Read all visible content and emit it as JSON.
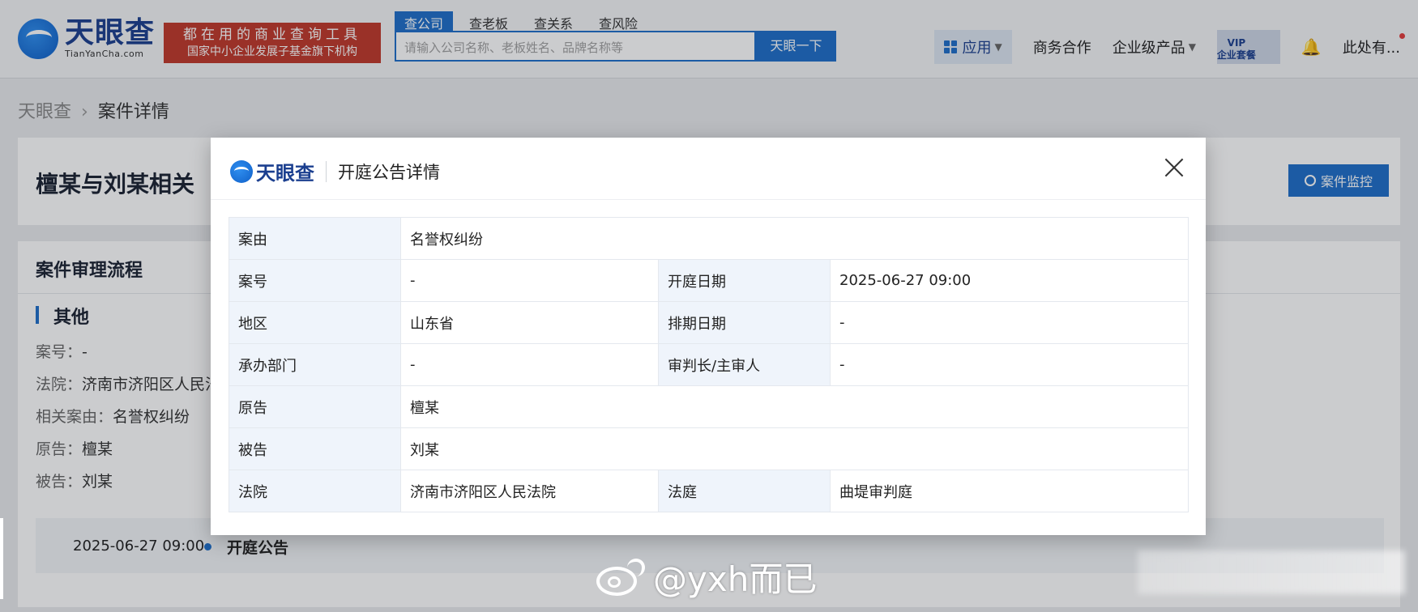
{
  "header": {
    "logo_name": "天眼查",
    "logo_sub": "TianYanCha.com",
    "slogan_line1": "都在用的商业查询工具",
    "slogan_line2": "国家中小企业发展子基金旗下机构",
    "search_tabs": [
      "查公司",
      "查老板",
      "查关系",
      "查风险"
    ],
    "search_placeholder": "请输入公司名称、老板姓名、品牌名称等",
    "search_button": "天眼一下",
    "nav": {
      "app": "应用",
      "business": "商务合作",
      "enterprise": "企业级产品",
      "vip_top": "VIP",
      "vip_bottom": "企业套餐",
      "user": "此处有..."
    }
  },
  "breadcrumb": {
    "home": "天眼查",
    "sep": "›",
    "current": "案件详情"
  },
  "case": {
    "title": "檀某与刘某相关",
    "monitor_button": "案件监控"
  },
  "process": {
    "section_title": "案件审理流程",
    "sub_title": "其他",
    "lines": [
      {
        "key": "案号：",
        "value": "-"
      },
      {
        "key": "法院：",
        "value": "济南市济阳区人民法"
      },
      {
        "key": "相关案由：",
        "value": "名誉权纠纷"
      },
      {
        "key": "原告：",
        "value": "檀某"
      },
      {
        "key": "被告：",
        "value": "刘某"
      }
    ],
    "timeline": {
      "date": "2025-06-27 09:00",
      "label": "开庭公告"
    }
  },
  "modal": {
    "logo_name": "天眼查",
    "title": "开庭公告详情",
    "rows": {
      "cause_label": "案由",
      "cause_value": "名誉权纠纷",
      "case_no_label": "案号",
      "case_no_value": "-",
      "hearing_date_label": "开庭日期",
      "hearing_date_value": "2025-06-27 09:00",
      "region_label": "地区",
      "region_value": "山东省",
      "schedule_date_label": "排期日期",
      "schedule_date_value": "-",
      "dept_label": "承办部门",
      "dept_value": "-",
      "judge_label": "审判长/主审人",
      "judge_value": "-",
      "plaintiff_label": "原告",
      "plaintiff_value": "檀某",
      "defendant_label": "被告",
      "defendant_value": "刘某",
      "court_label": "法院",
      "court_value": "济南市济阳区人民法院",
      "courtroom_label": "法庭",
      "courtroom_value": "曲堤审判庭"
    }
  },
  "watermark": {
    "text": "@yxh而已"
  },
  "colors": {
    "brand_blue": "#1f6fc9",
    "slogan_red": "#c0392b",
    "label_bg": "#eff4fb"
  }
}
